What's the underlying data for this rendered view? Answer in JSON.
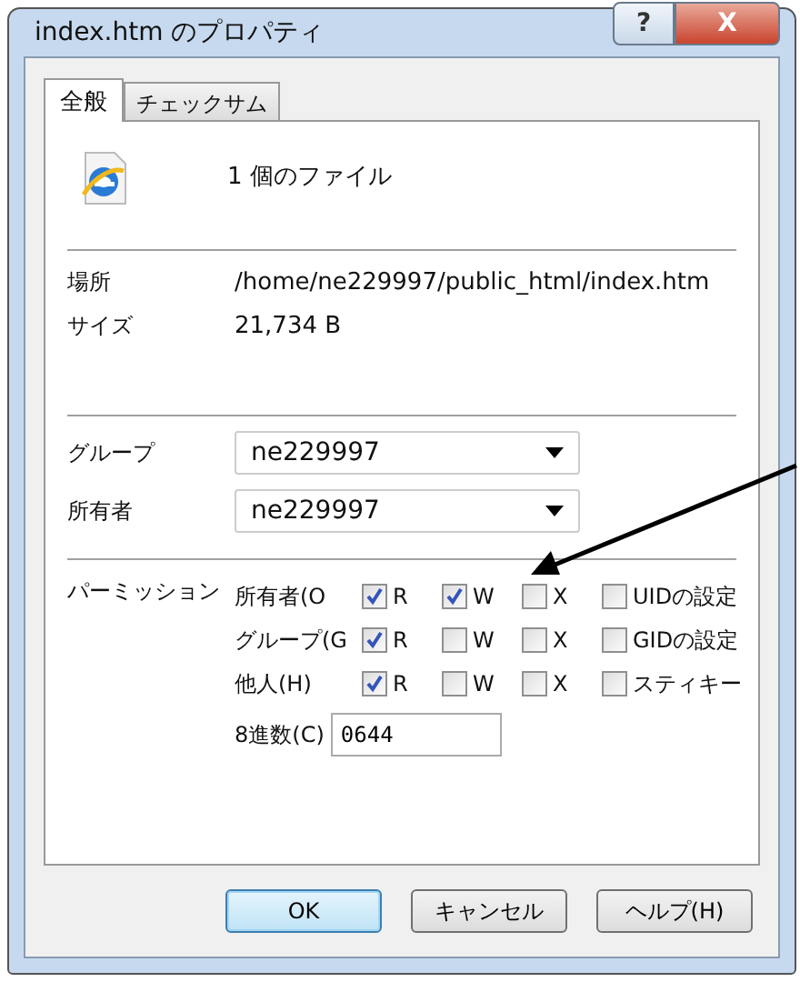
{
  "window": {
    "title": "index.htm のプロパティ",
    "help_button": "?",
    "close_button": "X"
  },
  "tabs": [
    {
      "label": "全般",
      "selected": true
    },
    {
      "label": "チェックサム",
      "selected": false
    }
  ],
  "file_summary": "1 個のファイル",
  "info": [
    {
      "label": "場所",
      "value": "/home/ne229997/public_html/index.htm"
    },
    {
      "label": "サイズ",
      "value": "21,734 B"
    }
  ],
  "dropdowns": [
    {
      "label": "グループ",
      "value": "ne229997"
    },
    {
      "label": "所有者",
      "value": "ne229997"
    }
  ],
  "permissions": {
    "label": "パーミッション",
    "rows": [
      {
        "label": "所有者(O",
        "boxes": [
          {
            "label": "R",
            "checked": true
          },
          {
            "label": "W",
            "checked": true
          },
          {
            "label": "X",
            "checked": false
          },
          {
            "label": "UIDの設定",
            "checked": false
          }
        ]
      },
      {
        "label": "グループ(G",
        "boxes": [
          {
            "label": "R",
            "checked": true
          },
          {
            "label": "W",
            "checked": false
          },
          {
            "label": "X",
            "checked": false
          },
          {
            "label": "GIDの設定",
            "checked": false
          }
        ]
      },
      {
        "label": "他人(H)",
        "boxes": [
          {
            "label": "R",
            "checked": true
          },
          {
            "label": "W",
            "checked": false
          },
          {
            "label": "X",
            "checked": false
          },
          {
            "label": "スティキー",
            "checked": false
          }
        ]
      }
    ],
    "octal_label": "8進数(C)",
    "octal_value": "0644"
  },
  "buttons": [
    {
      "label": "OK",
      "kind": "default"
    },
    {
      "label": "キャンセル",
      "kind": "normal"
    },
    {
      "label": "ヘルプ(H)",
      "kind": "normal"
    }
  ]
}
